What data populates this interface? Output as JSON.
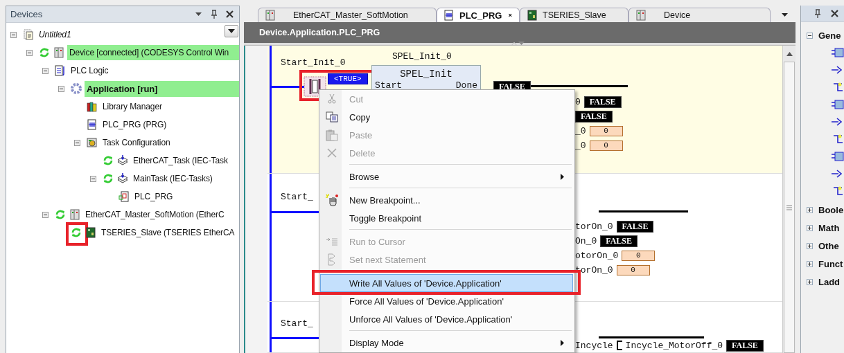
{
  "devices_panel": {
    "title": "Devices",
    "tree": [
      {
        "label": "Untitled1",
        "kind": "project",
        "expanded": true,
        "online": false,
        "highlighted": false,
        "active": false,
        "callout": false,
        "children": [
          {
            "label": "Device [connected] (CODESYS Control Win",
            "kind": "device",
            "expanded": true,
            "online": true,
            "highlighted": true,
            "active": false,
            "callout": false,
            "children": [
              {
                "label": "PLC Logic",
                "kind": "plc-logic",
                "expanded": true,
                "online": false,
                "highlighted": false,
                "active": false,
                "callout": false,
                "children": [
                  {
                    "label": "Application [run]",
                    "kind": "application",
                    "expanded": true,
                    "online": false,
                    "highlighted": true,
                    "active": true,
                    "callout": false,
                    "children": [
                      {
                        "label": "Library Manager",
                        "kind": "library",
                        "online": false,
                        "highlighted": false,
                        "active": false,
                        "callout": false
                      },
                      {
                        "label": "PLC_PRG (PRG)",
                        "kind": "pou",
                        "online": false,
                        "highlighted": false,
                        "active": false,
                        "callout": false
                      },
                      {
                        "label": "Task Configuration",
                        "kind": "task-config",
                        "expanded": true,
                        "online": false,
                        "highlighted": false,
                        "active": false,
                        "callout": false,
                        "children": [
                          {
                            "label": "EtherCAT_Task (IEC-Task",
                            "kind": "task",
                            "online": true,
                            "highlighted": false,
                            "active": false,
                            "callout": false
                          },
                          {
                            "label": "MainTask (IEC-Tasks)",
                            "kind": "task",
                            "expanded": true,
                            "online": true,
                            "highlighted": false,
                            "active": false,
                            "callout": false,
                            "children": [
                              {
                                "label": "PLC_PRG",
                                "kind": "pou-ref",
                                "online": false,
                                "highlighted": false,
                                "active": false,
                                "callout": false
                              }
                            ]
                          }
                        ]
                      }
                    ]
                  }
                ]
              },
              {
                "label": "EtherCAT_Master_SoftMotion (EtherC",
                "kind": "device",
                "expanded": true,
                "online": true,
                "highlighted": false,
                "active": false,
                "callout": false,
                "children": [
                  {
                    "label": "TSERIES_Slave (TSERIES EtherCA",
                    "kind": "slave",
                    "online": true,
                    "highlighted": false,
                    "active": false,
                    "callout": true
                  }
                ]
              }
            ]
          }
        ]
      }
    ]
  },
  "editor": {
    "tabs": [
      {
        "label": "EtherCAT_Master_SoftMotion",
        "kind": "device",
        "selected": false
      },
      {
        "label": "PLC_PRG",
        "kind": "pou",
        "selected": true
      },
      {
        "label": "TSERIES_Slave",
        "kind": "slave",
        "selected": false
      },
      {
        "label": "Device",
        "kind": "device",
        "selected": false
      }
    ],
    "breadcrumb": "Device.Application.PLC_PRG",
    "rungs": [
      {
        "contact": "Start_Init_0",
        "contact_value": "<TRUE>",
        "callout": true,
        "block": {
          "instance": "SPEL_Init_0",
          "type": "SPEL_Init",
          "input": "Start",
          "output": "Done",
          "output_value": "FALSE"
        },
        "outputs": [
          {
            "name": "0",
            "value": "FALSE",
            "kind": "bool"
          },
          {
            "value": "FALSE",
            "kind": "bool"
          },
          {
            "name": "_0",
            "value": "0",
            "kind": "int"
          },
          {
            "name": "_0",
            "value": "0",
            "kind": "int"
          }
        ]
      },
      {
        "contact": "Start_",
        "outputs": [
          {
            "name": "torOn_0",
            "value": "FALSE",
            "kind": "bool"
          },
          {
            "name": "On_0",
            "value": "FALSE",
            "kind": "bool"
          },
          {
            "name": "otorOn_0",
            "value": "0",
            "kind": "int"
          },
          {
            "name": "torOn_0",
            "value": "0",
            "kind": "int"
          }
        ]
      },
      {
        "contact": "Start_",
        "outputs": [
          {
            "pin": "Incycle",
            "name": "Incycle_MotorOff_0",
            "value": "FALSE",
            "kind": "bool"
          }
        ]
      }
    ]
  },
  "context_menu": {
    "items": [
      {
        "kind": "item",
        "label": "Cut",
        "disabled": true,
        "selected": false,
        "submenu": false,
        "callout": false
      },
      {
        "kind": "item",
        "label": "Copy",
        "disabled": false,
        "selected": false,
        "submenu": false,
        "callout": false
      },
      {
        "kind": "item",
        "label": "Paste",
        "disabled": true,
        "selected": false,
        "submenu": false,
        "callout": false
      },
      {
        "kind": "item",
        "label": "Delete",
        "disabled": true,
        "selected": false,
        "submenu": false,
        "callout": false
      },
      {
        "kind": "separator"
      },
      {
        "kind": "item",
        "label": "Browse",
        "disabled": false,
        "selected": false,
        "submenu": true,
        "callout": false
      },
      {
        "kind": "separator"
      },
      {
        "kind": "item",
        "label": "New Breakpoint...",
        "disabled": false,
        "selected": false,
        "submenu": false,
        "callout": false
      },
      {
        "kind": "item",
        "label": "Toggle Breakpoint",
        "disabled": false,
        "selected": false,
        "submenu": false,
        "callout": false
      },
      {
        "kind": "separator"
      },
      {
        "kind": "item",
        "label": "Run to Cursor",
        "disabled": true,
        "selected": false,
        "submenu": false,
        "callout": false
      },
      {
        "kind": "item",
        "label": "Set next Statement",
        "disabled": true,
        "selected": false,
        "submenu": false,
        "callout": false
      },
      {
        "kind": "separator"
      },
      {
        "kind": "item",
        "label": "Write All Values of 'Device.Application'",
        "disabled": false,
        "selected": true,
        "submenu": false,
        "callout": true
      },
      {
        "kind": "item",
        "label": "Force All Values of 'Device.Application'",
        "disabled": false,
        "selected": false,
        "submenu": false,
        "callout": false
      },
      {
        "kind": "item",
        "label": "Unforce All Values of 'Device.Application'",
        "disabled": false,
        "selected": false,
        "submenu": false,
        "callout": false
      },
      {
        "kind": "separator"
      },
      {
        "kind": "item",
        "label": "Display Mode",
        "disabled": false,
        "selected": false,
        "submenu": true,
        "callout": false
      }
    ]
  },
  "toolbox": {
    "groups": [
      {
        "label": "Gene",
        "expanded": true
      },
      {
        "label": "Boole",
        "expanded": false
      },
      {
        "label": "Math",
        "expanded": false
      },
      {
        "label": "Othe",
        "expanded": false
      },
      {
        "label": "Funct",
        "expanded": false
      },
      {
        "label": "Ladd",
        "expanded": false
      }
    ]
  }
}
